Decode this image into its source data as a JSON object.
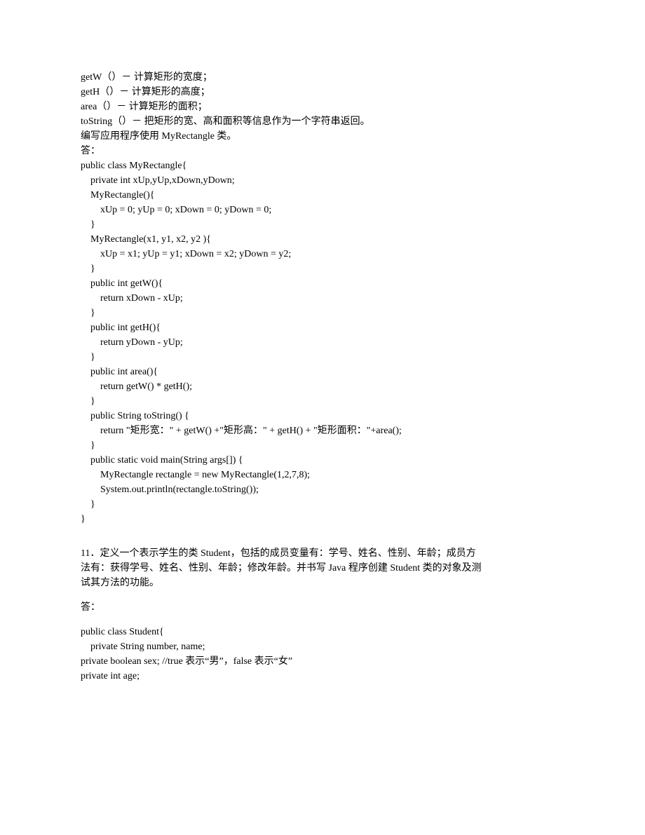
{
  "intro": [
    "getW（）－ 计算矩形的宽度；",
    "getH（）－ 计算矩形的高度；",
    "area（）－ 计算矩形的面积；",
    "toString（）－ 把矩形的宽、高和面积等信息作为一个字符串返回。",
    "编写应用程序使用 MyRectangle 类。",
    "答："
  ],
  "code1": [
    "public class MyRectangle{",
    "    private int xUp,yUp,xDown,yDown;",
    "    MyRectangle(){",
    "        xUp = 0; yUp = 0; xDown = 0; yDown = 0;",
    "    }",
    "    MyRectangle(x1, y1, x2, y2 ){",
    "        xUp = x1; yUp = y1; xDown = x2; yDown = y2;",
    "    }",
    "    public int getW(){",
    "        return xDown - xUp;",
    "    }",
    "    public int getH(){",
    "        return yDown - yUp;",
    "    }",
    "    public int area(){",
    "        return getW() * getH();",
    "    }",
    "    public String toString() {",
    "        return \"矩形宽：\" + getW() +\"矩形高：\" + getH() + \"矩形面积：\"+area();",
    "    }",
    "    public static void main(String args[]) {",
    "        MyRectangle rectangle = new MyRectangle(1,2,7,8);",
    "        System.out.println(rectangle.toString());",
    "    }",
    "}"
  ],
  "question": [
    "11．定义一个表示学生的类 Student，包括的成员变量有：学号、姓名、性别、年龄；成员方",
    "法有：获得学号、姓名、性别、年龄；修改年龄。并书写 Java 程序创建 Student 类的对象及测",
    "试其方法的功能。"
  ],
  "answerLabel": "答：",
  "code2": [
    "public class Student{",
    "",
    "    private String number, name;",
    "",
    "private boolean sex; //true 表示“男”，false 表示“女”",
    "",
    "private int age;"
  ]
}
